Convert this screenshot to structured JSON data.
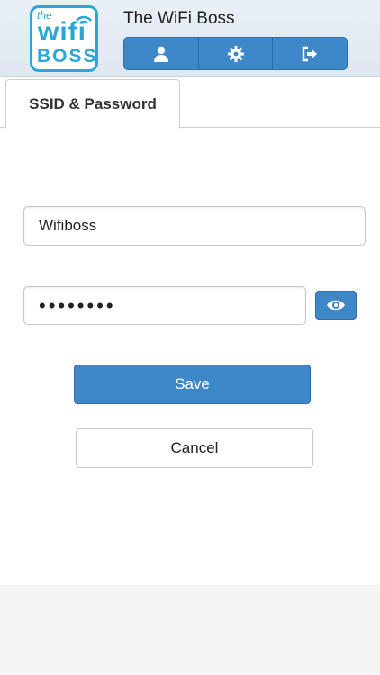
{
  "header": {
    "logo": {
      "the": "the",
      "wifi": "wifi",
      "boss": "BOSS"
    },
    "title": "The WiFi Boss",
    "toolbar": [
      {
        "icon": "user-icon"
      },
      {
        "icon": "gear-icon"
      },
      {
        "icon": "logout-icon"
      }
    ]
  },
  "tabs": [
    {
      "label": "SSID & Password",
      "active": true
    }
  ],
  "form": {
    "ssid_value": "Wifiboss",
    "password_value": "••••••••",
    "show_password_icon": "eye-icon",
    "save_label": "Save",
    "cancel_label": "Cancel"
  },
  "colors": {
    "accent": "#3e87c9",
    "logo": "#2aa7d9"
  }
}
